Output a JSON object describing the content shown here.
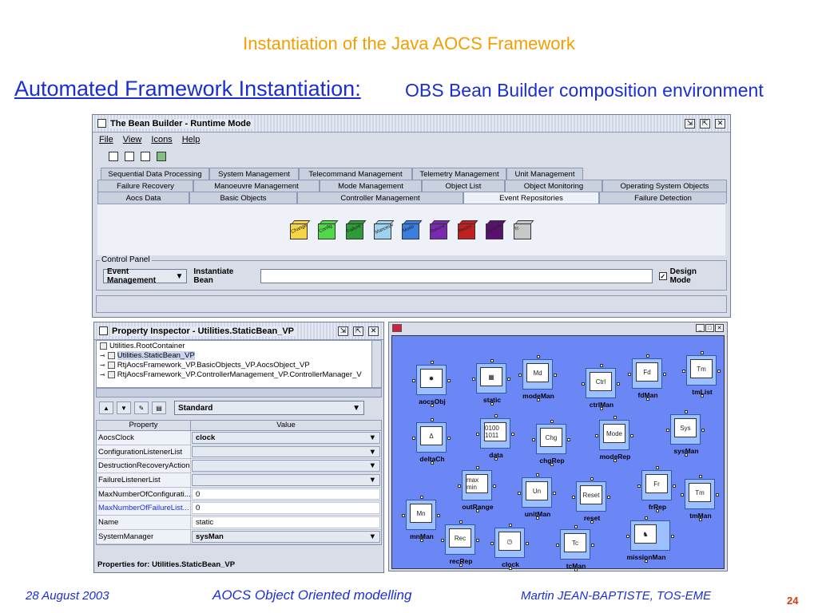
{
  "slide": {
    "title": "Instantiation of the Java AOCS Framework",
    "subtitle_link": "Automated Framework Instantiation:",
    "subtitle_rest": "OBS Bean Builder composition environment"
  },
  "footer": {
    "date": "28 August 2003",
    "center": "AOCS Object Oriented modelling",
    "author": "Martin JEAN-BAPTISTE, TOS-EME",
    "page": "24"
  },
  "bean_builder": {
    "title": "The Bean Builder - Runtime Mode",
    "menu": [
      "File",
      "View",
      "Icons",
      "Help"
    ],
    "tab_rows": [
      [
        "Sequential Data Processing",
        "System Management",
        "Telecommand Management",
        "Telemetry Management",
        "Unit Management"
      ],
      [
        "Failure Recovery",
        "Manoeuvre Management",
        "Mode Management",
        "Object List",
        "Object Monitoring",
        "Operating System Objects"
      ],
      [
        "Aocs Data",
        "Basic Objects",
        "Controller Management",
        "Event Repositories",
        "Failure Detection"
      ]
    ],
    "active_tab": "Event Repositories",
    "palette": [
      {
        "label": "Change",
        "color": "#f5d445"
      },
      {
        "label": "Config",
        "color": "#4fd94a"
      },
      {
        "label": "Failure",
        "color": "#2e9a3a"
      },
      {
        "label": "Manoeuv",
        "color": "#9fd2ee"
      },
      {
        "label": "Mode",
        "color": "#3a7ee0"
      },
      {
        "label": "Recovt",
        "color": "#7a2ab0"
      },
      {
        "label": "Recov",
        "color": "#c02020"
      },
      {
        "label": "System",
        "color": "#5a1070"
      },
      {
        "label": "Tc",
        "color": "#c8c8c8"
      }
    ],
    "control_panel": {
      "legend": "Control Panel",
      "select_value": "Event Management",
      "instantiate_label": "Instantiate Bean",
      "design_mode_label": "Design Mode",
      "design_mode_checked": true
    }
  },
  "property_inspector": {
    "title": "Property Inspector - Utilities.StaticBean_VP",
    "tree": [
      "Utilities.RootContainer",
      "Utilities.StaticBean_VP",
      "RtjAocsFramework_VP.BasicObjects_VP.AocsObject_VP",
      "RtjAocsFramework_VP.ControllerManagement_VP.ControllerManager_V"
    ],
    "selected_tree_item": "Utilities.StaticBean_VP",
    "view_select": "Standard",
    "columns": [
      "Property",
      "Value"
    ],
    "rows": [
      {
        "name": "AocsClock",
        "value": "clock",
        "kind": "combo",
        "blue": false
      },
      {
        "name": "ConfigurationListenerList",
        "value": "",
        "kind": "combo",
        "blue": false
      },
      {
        "name": "DestructionRecoveryAction",
        "value": "",
        "kind": "combo",
        "blue": false
      },
      {
        "name": "FailureListenerList",
        "value": "",
        "kind": "combo",
        "blue": false
      },
      {
        "name": "MaxNumberOfConfigurati...",
        "value": "0",
        "kind": "text",
        "blue": false
      },
      {
        "name": "MaxNumberOfFailureList...",
        "value": "0",
        "kind": "text",
        "blue": true
      },
      {
        "name": "Name",
        "value": "static",
        "kind": "text",
        "blue": false
      },
      {
        "name": "SystemManager",
        "value": "sysMan",
        "kind": "combo",
        "blue": false
      }
    ],
    "footer": "Properties for:  Utilities.StaticBean_VP"
  },
  "canvas": {
    "nodes": [
      {
        "id": "aocsObj",
        "glyph": "✹"
      },
      {
        "id": "static",
        "glyph": "▦"
      },
      {
        "id": "modeMan",
        "glyph": "Md"
      },
      {
        "id": "ctrlMan",
        "glyph": "Ctrl"
      },
      {
        "id": "fdMan",
        "glyph": "Fd"
      },
      {
        "id": "tmList",
        "glyph": "Tm"
      },
      {
        "id": "deltaCh",
        "glyph": "Δ"
      },
      {
        "id": "data",
        "glyph": "0100 1011"
      },
      {
        "id": "chgRep",
        "glyph": "Chg"
      },
      {
        "id": "modeRep",
        "glyph": "Mode"
      },
      {
        "id": "sysMan",
        "glyph": "Sys"
      },
      {
        "id": "outRange",
        "glyph": "max min"
      },
      {
        "id": "unitMan",
        "glyph": "Un"
      },
      {
        "id": "reset",
        "glyph": "Reset"
      },
      {
        "id": "frRep",
        "glyph": "Fr"
      },
      {
        "id": "tmMan",
        "glyph": "Tm"
      },
      {
        "id": "mnMan",
        "glyph": "Mn"
      },
      {
        "id": "recRep",
        "glyph": "Rec"
      },
      {
        "id": "clock",
        "glyph": "◷"
      },
      {
        "id": "tcMan",
        "glyph": "Tc"
      },
      {
        "id": "missionMan",
        "glyph": "♞"
      }
    ]
  }
}
